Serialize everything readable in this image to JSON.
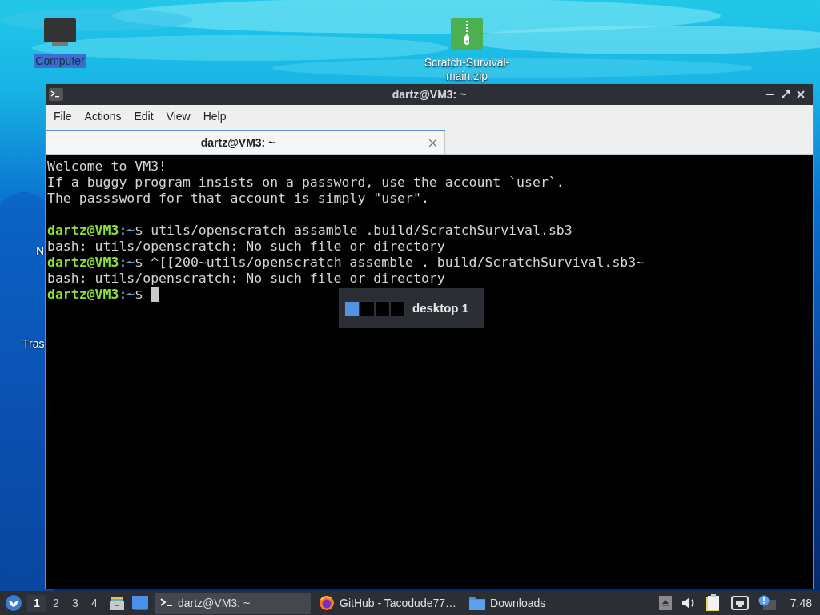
{
  "desktop_icons": [
    {
      "label": "Computer",
      "kind": "monitor",
      "selected": true
    },
    {
      "label": "Scratch-Survival-main.zip",
      "kind": "zip",
      "selected": false
    },
    {
      "label": "N",
      "kind": "hidden",
      "selected": false
    },
    {
      "label": "Tras",
      "kind": "hidden",
      "selected": false
    }
  ],
  "window": {
    "title": "dartz@VM3: ~",
    "menu": [
      "File",
      "Actions",
      "Edit",
      "View",
      "Help"
    ],
    "tabs": [
      {
        "label": "dartz@VM3: ~",
        "selected": true
      }
    ]
  },
  "terminal": {
    "lines": [
      {
        "kind": "output",
        "text": "Welcome to VM3!"
      },
      {
        "kind": "output",
        "text": "If a buggy program insists on a password, use the account `user`."
      },
      {
        "kind": "output",
        "text": "The passsword for that account is simply \"user\"."
      },
      {
        "kind": "blank"
      },
      {
        "kind": "prompt",
        "user": "dartz@VM3",
        "sep": ":",
        "path": "~",
        "sign": "$",
        "command": "utils/openscratch assamble .build/ScratchSurvival.sb3",
        "cursor": false
      },
      {
        "kind": "output",
        "text": "bash: utils/openscratch: No such file or directory"
      },
      {
        "kind": "prompt",
        "user": "dartz@VM3",
        "sep": ":",
        "path": "~",
        "sign": "$",
        "command": "^[[200~utils/openscratch assemble . build/ScratchSurvival.sb3~",
        "cursor": false
      },
      {
        "kind": "output",
        "text": "bash: utils/openscratch: No such file or directory"
      },
      {
        "kind": "prompt",
        "user": "dartz@VM3",
        "sep": ":",
        "path": "~",
        "sign": "$",
        "cursor": true
      }
    ]
  },
  "pager_popup": {
    "desktops": [
      {
        "selected": true
      },
      {
        "selected": false
      },
      {
        "selected": false
      },
      {
        "selected": false
      }
    ],
    "label": "desktop 1"
  },
  "taskbar": {
    "workspaces": [
      {
        "label": "1",
        "selected": true
      },
      {
        "label": "2",
        "selected": false
      },
      {
        "label": "3",
        "selected": false
      },
      {
        "label": "4",
        "selected": false
      }
    ],
    "tasks": [
      {
        "label": "dartz@VM3: ~",
        "kind": "terminal",
        "selected": true
      },
      {
        "label": "GitHub - Tacodude77…",
        "kind": "browser",
        "selected": false
      },
      {
        "label": "Downloads",
        "kind": "folder",
        "selected": false
      }
    ],
    "clock": "7:48"
  }
}
